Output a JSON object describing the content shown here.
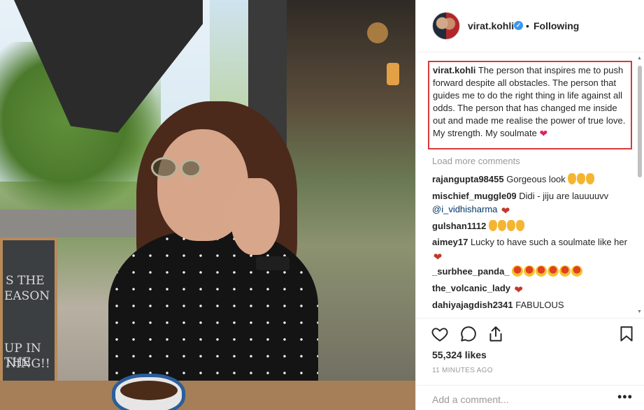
{
  "post": {
    "username": "virat.kohli",
    "verified_badge": "✓",
    "separator": "•",
    "follow_status": "Following",
    "caption_text": "The person that inspires me to push forward despite all obstacles. The person that guides me to do the right thing in life against all odds. The person that has changed me inside out and made me realise the power of true love. My strength. My soulmate",
    "caption_emoji": "❤",
    "load_more": "Load more comments",
    "likes": "55,324 likes",
    "time": "11 MINUTES AGO",
    "add_comment_placeholder": "Add a comment...",
    "more_options": "•••"
  },
  "photo": {
    "sign_lines": [
      "S THE",
      "EASON",
      "UP IN THE",
      "NING!!"
    ]
  },
  "comments": [
    {
      "user": "rajangupta98455",
      "text": "Gorgeous look",
      "emoji": [
        "ok-hand",
        "ok-hand",
        "ok-hand"
      ]
    },
    {
      "user": "mischief_muggle09",
      "text": "Didi - jiju are lauuuuvv",
      "mention": "@i_vidhisharma",
      "emoji": [
        "heart"
      ]
    },
    {
      "user": "gulshan1112",
      "text": "",
      "emoji": [
        "ok-hand",
        "ok-hand",
        "ok-hand",
        "ok-hand"
      ]
    },
    {
      "user": "aimey17",
      "text": "Lucky to have such a soulmate like her",
      "emoji": [
        "heart"
      ]
    },
    {
      "user": "_surbhee_panda_",
      "text": "",
      "emoji": [
        "star-eyes",
        "star-eyes",
        "star-eyes",
        "star-eyes",
        "star-eyes",
        "star-eyes"
      ]
    },
    {
      "user": "the_volcanic_lady",
      "text": "",
      "emoji": [
        "heart"
      ]
    },
    {
      "user": "dahiyajagdish2341",
      "text": "FABULOUS",
      "emoji": []
    }
  ],
  "icons": {
    "like": "heart-icon",
    "comment": "comment-icon",
    "share": "share-icon",
    "save": "bookmark-icon"
  },
  "colors": {
    "highlight_border": "#d63a3a",
    "verified": "#3897f0",
    "muted_text": "#999999"
  }
}
